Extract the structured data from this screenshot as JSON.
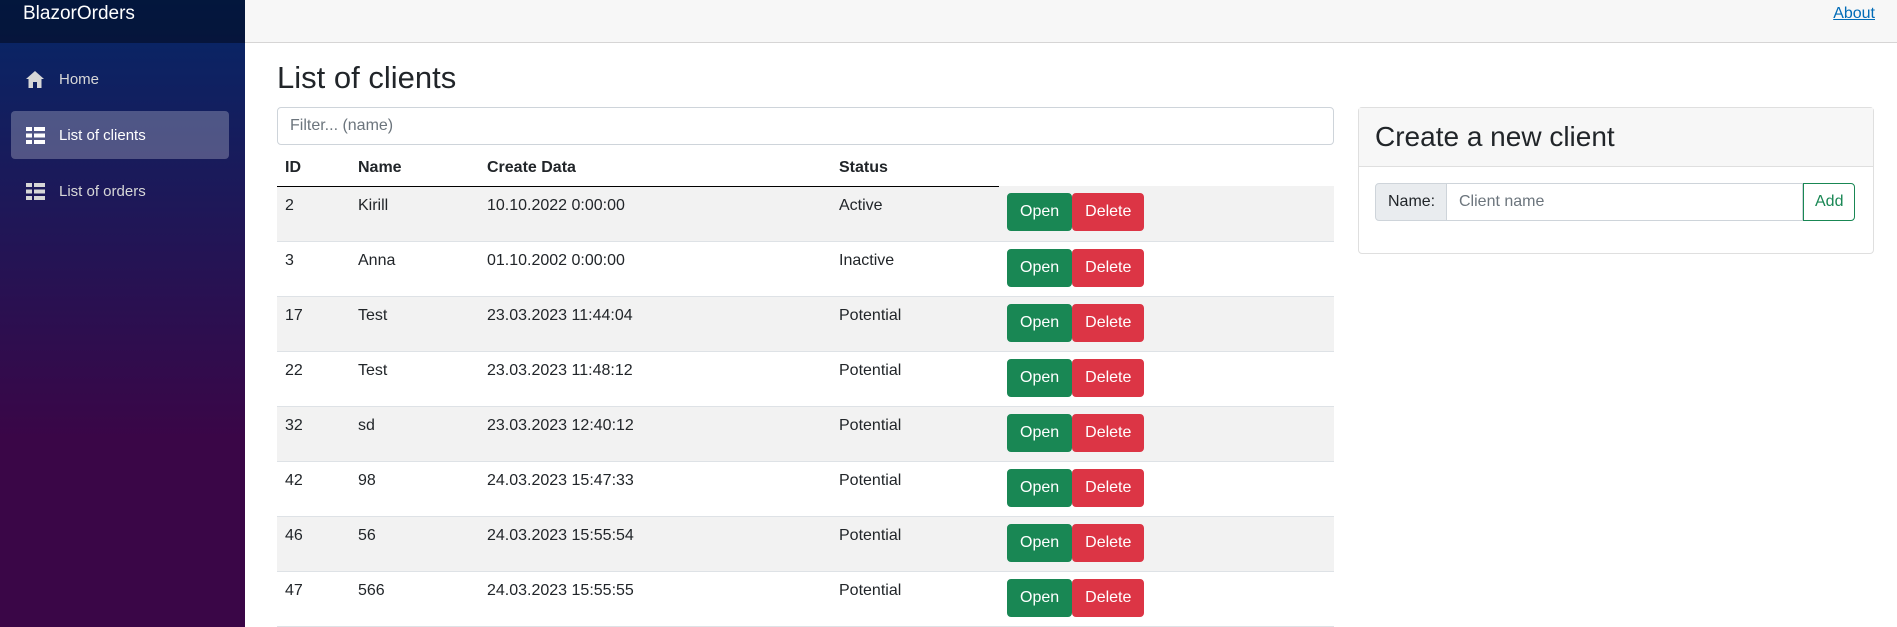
{
  "app": {
    "brand": "BlazorOrders"
  },
  "sidebar": {
    "items": [
      {
        "label": "Home",
        "icon": "home-icon",
        "active": false
      },
      {
        "label": "List of clients",
        "icon": "list-icon",
        "active": true
      },
      {
        "label": "List of orders",
        "icon": "list-icon",
        "active": false
      }
    ]
  },
  "topbar": {
    "about_label": "About"
  },
  "main": {
    "title": "List of clients",
    "filter_placeholder": "Filter... (name)",
    "table": {
      "headers": [
        "ID",
        "Name",
        "Create Data",
        "Status"
      ],
      "open_label": "Open",
      "delete_label": "Delete",
      "rows": [
        {
          "id": "2",
          "name": "Kirill",
          "created": "10.10.2022 0:00:00",
          "status": "Active"
        },
        {
          "id": "3",
          "name": "Anna",
          "created": "01.10.2002 0:00:00",
          "status": "Inactive"
        },
        {
          "id": "17",
          "name": "Test",
          "created": "23.03.2023 11:44:04",
          "status": "Potential"
        },
        {
          "id": "22",
          "name": "Test",
          "created": "23.03.2023 11:48:12",
          "status": "Potential"
        },
        {
          "id": "32",
          "name": "sd",
          "created": "23.03.2023 12:40:12",
          "status": "Potential"
        },
        {
          "id": "42",
          "name": "98",
          "created": "24.03.2023 15:47:33",
          "status": "Potential"
        },
        {
          "id": "46",
          "name": "56",
          "created": "24.03.2023 15:55:54",
          "status": "Potential"
        },
        {
          "id": "47",
          "name": "566",
          "created": "24.03.2023 15:55:55",
          "status": "Potential"
        }
      ]
    }
  },
  "create_card": {
    "title": "Create a new client",
    "name_label": "Name:",
    "name_placeholder": "Client name",
    "add_label": "Add"
  },
  "colors": {
    "open_button": "#198754",
    "delete_button": "#dc3545",
    "link": "#006bb7"
  }
}
